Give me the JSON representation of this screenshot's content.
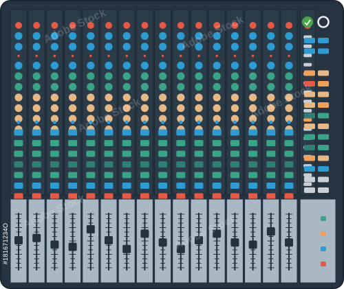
{
  "watermark_text": "Adobe Stock",
  "credit_id": "#181671234O",
  "colors": {
    "body": "#253440",
    "body_edge": "#1b2730",
    "strip": "#2b3b48",
    "strip_line": "#1c2832",
    "red": "#e55a46",
    "blue": "#2e9bd2",
    "green": "#3aa388",
    "tan": "#e6b886",
    "teal": "#2f7f74",
    "grey": "#c9d0d8",
    "orange": "#f0a058",
    "fader_panel": "#a9b8c3",
    "fader_line": "#24313b",
    "knob_cap": "#25313b",
    "master_green": "#4aa64c"
  },
  "layout": {
    "channel_count": 16,
    "knob_rows": [
      "red",
      "blue",
      "blue",
      "dot",
      "blue",
      "green",
      "green",
      "tan",
      "tan",
      "tan",
      "tan"
    ],
    "button_rows": [
      "dot",
      "blue",
      "green",
      "green",
      "teal",
      "green",
      "blue",
      "red"
    ],
    "fader_levels": [
      0.5,
      0.55,
      0.4,
      0.35,
      0.75,
      0.5,
      0.3,
      0.65,
      0.45,
      0.3,
      0.5,
      0.65,
      0.45,
      0.4,
      0.7,
      0.45
    ],
    "master_column_rows": [
      "red",
      "grey",
      "grey",
      "grey",
      "grey",
      "grey",
      "grey",
      "grey",
      "grey",
      "grey",
      "orange",
      "grey",
      "orange",
      "grey",
      "grey",
      "grey",
      "grey",
      "grey"
    ],
    "master_pairs": [
      [
        "blue",
        "blue"
      ],
      [
        "blue",
        "blue"
      ],
      [
        "orange",
        "tan"
      ],
      [
        "red",
        "orange"
      ],
      [
        "tan",
        "tan"
      ],
      [
        "tan",
        "orange"
      ],
      [
        "teal",
        "green"
      ],
      [
        "tan",
        "tan"
      ],
      [
        "green",
        "green"
      ],
      [
        "teal",
        "green"
      ],
      [
        "orange",
        "tan"
      ],
      [
        "blue",
        "blue"
      ],
      [
        "grey",
        "grey"
      ],
      [
        "grey",
        "grey"
      ]
    ],
    "master_leds": [
      "green",
      "orange",
      "blue",
      "red"
    ]
  }
}
